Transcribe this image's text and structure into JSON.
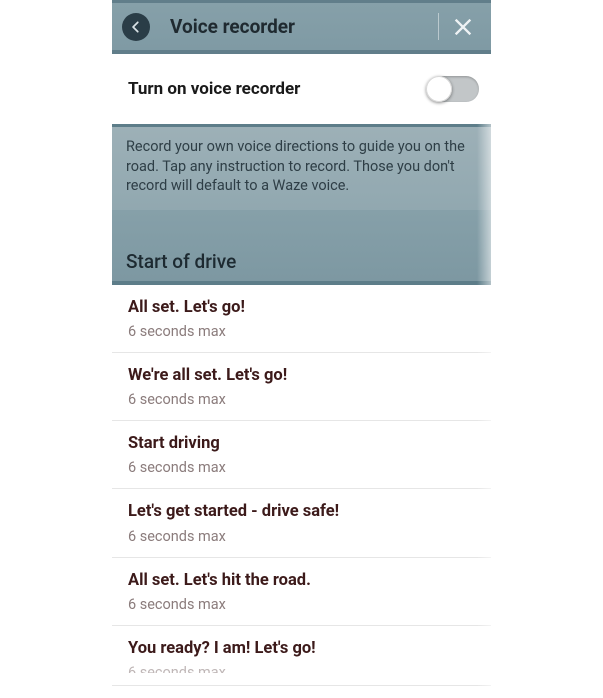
{
  "header": {
    "title": "Voice recorder"
  },
  "toggle": {
    "label": "Turn on voice recorder",
    "on": false
  },
  "info": {
    "text": "Record your own voice directions to guide you on the road. Tap any instruction to record. Those you don't record will default to a Waze voice."
  },
  "section": {
    "title": "Start of drive"
  },
  "common": {
    "sub": "6 seconds max"
  },
  "items": [
    {
      "label": "All set. Let's go!"
    },
    {
      "label": "We're all set. Let's go!"
    },
    {
      "label": "Start driving"
    },
    {
      "label": "Let's get started - drive safe!"
    },
    {
      "label": "All set. Let's hit the road."
    },
    {
      "label": "You ready? I am! Let's go!"
    }
  ]
}
